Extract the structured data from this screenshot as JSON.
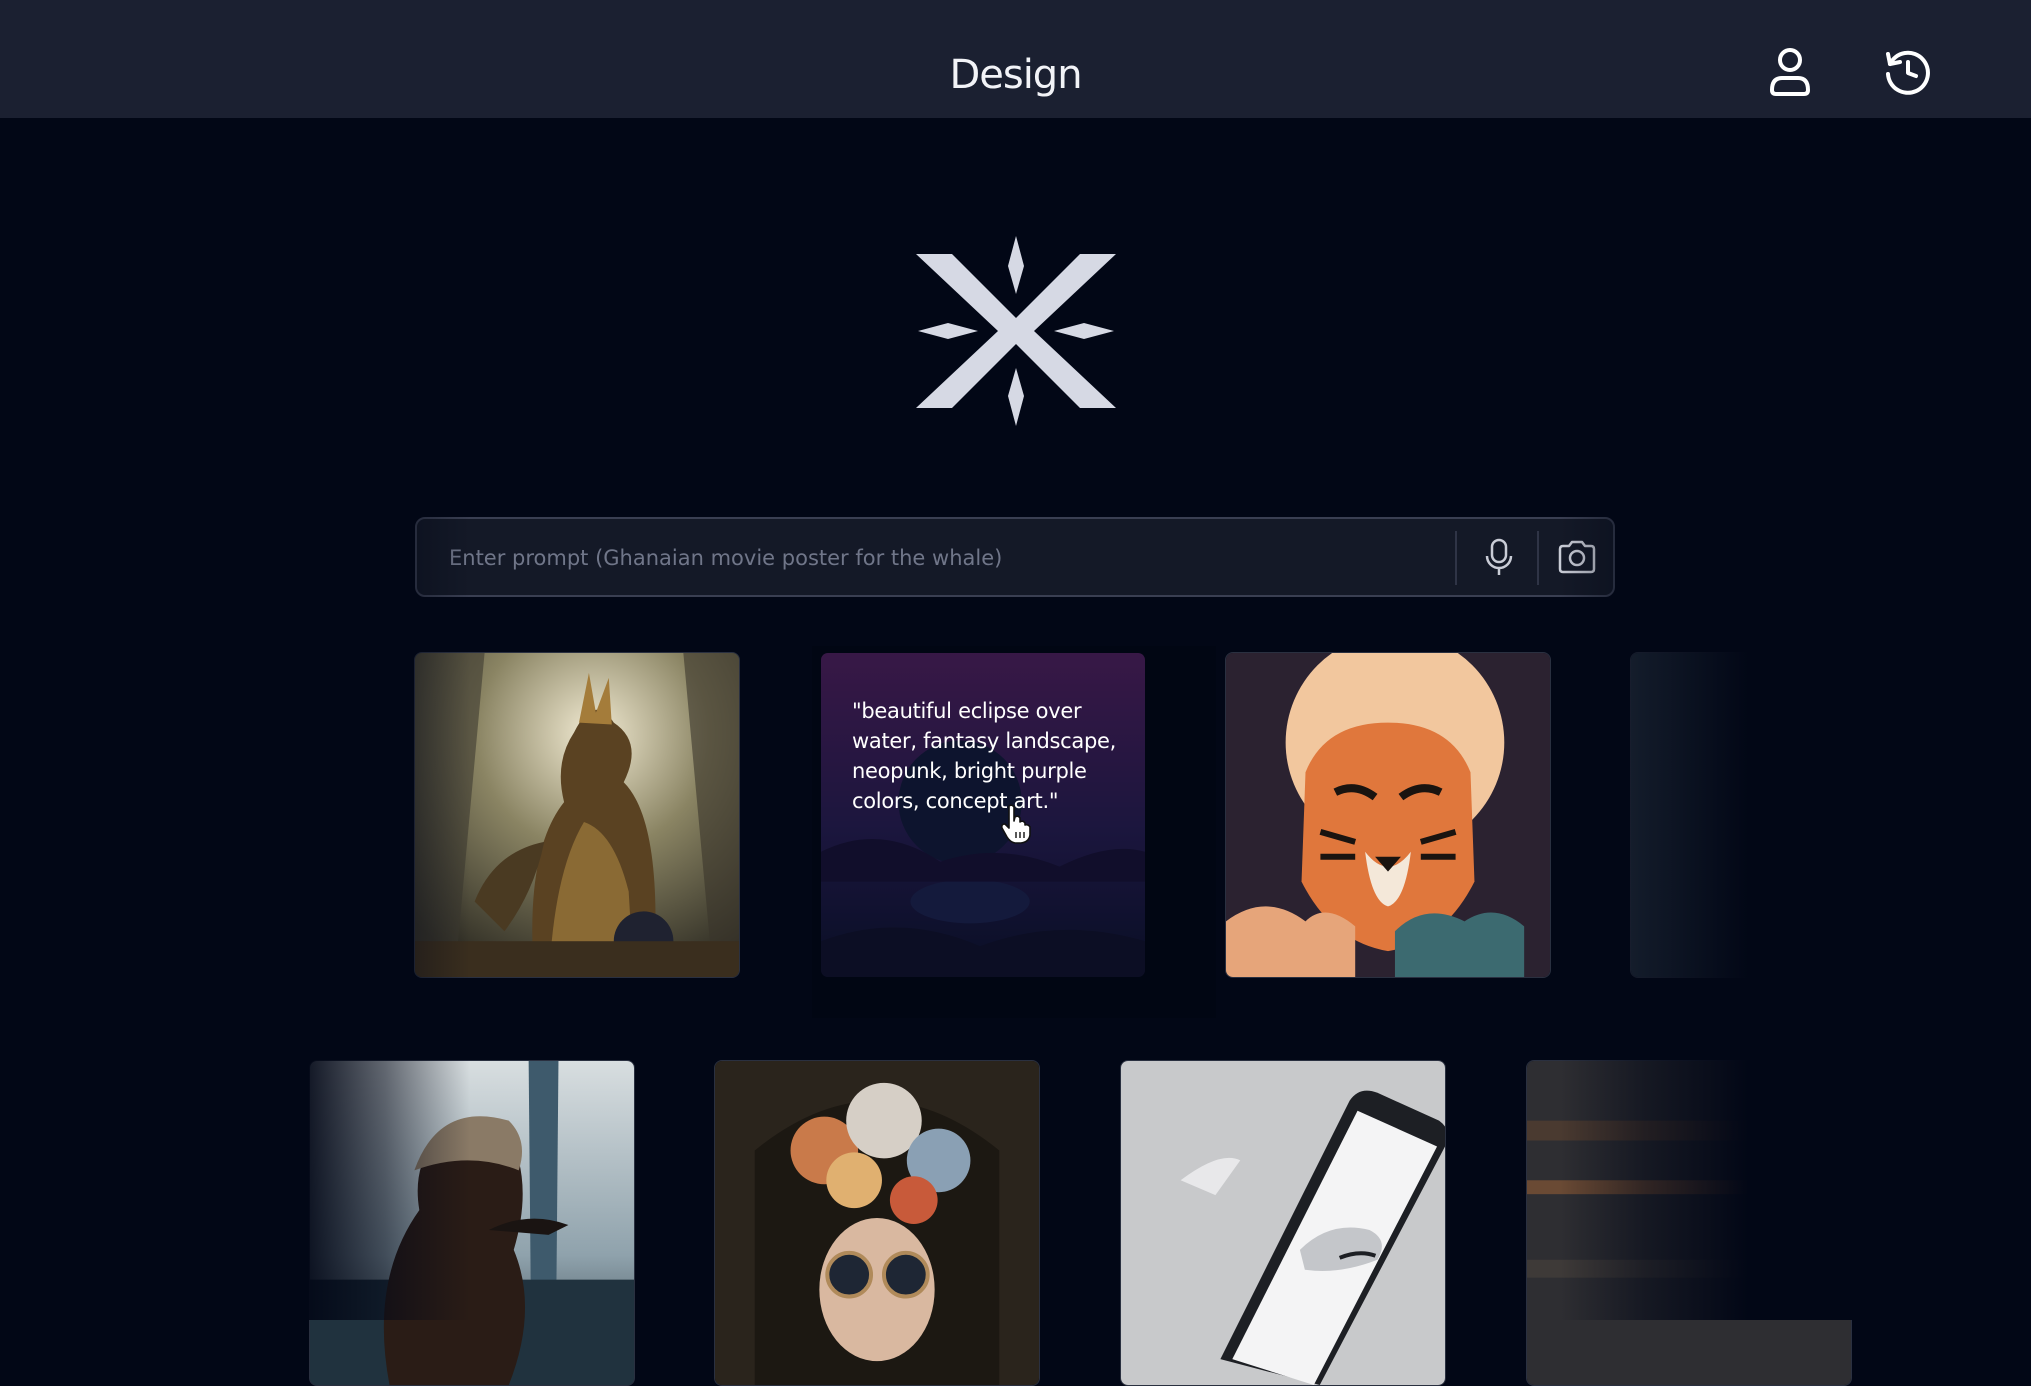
{
  "header": {
    "title": "Design",
    "user_icon": "user-icon",
    "history_icon": "history-icon"
  },
  "logo": {
    "icon": "asterisk-x-logo-icon"
  },
  "prompt": {
    "placeholder": "Enter prompt (Ghanaian movie poster for the whale)",
    "value": "",
    "mic_icon": "microphone-icon",
    "camera_icon": "camera-icon"
  },
  "gallery": {
    "row1": [
      "armored dragon warrior",
      "eclipse over water",
      "tiger illustration"
    ],
    "row2": [
      "man with turban and whale",
      "woman with flower headdress",
      "phone with sneaker"
    ],
    "hover_caption": "\"beautiful eclipse over water, fantasy landscape, neopunk, bright purple colors, concept art.\""
  },
  "colors": {
    "background": "#020716",
    "topbar": "#1b2031",
    "text": "#f2f3f7",
    "placeholder": "#707689"
  }
}
